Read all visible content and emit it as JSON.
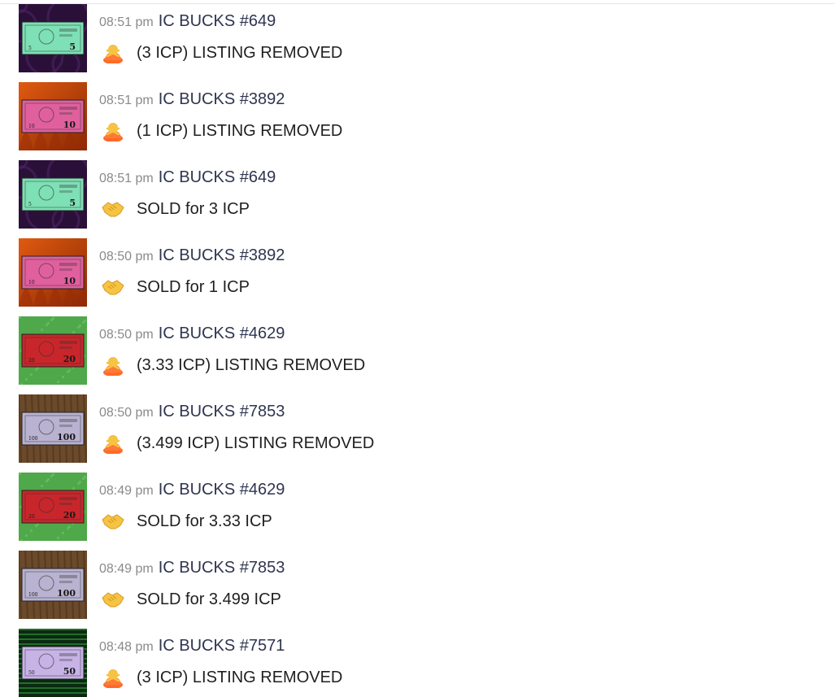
{
  "items": [
    {
      "time": "08:51 pm",
      "title": "IC BUCKS #649",
      "action": "(3 ICP) LISTING REMOVED",
      "action_icon": "person-gesturing-no-icon",
      "bill_value": "5",
      "bg": "#2a1038",
      "bill_color": "#7ee0b5",
      "pattern": "purple-swirl"
    },
    {
      "time": "08:51 pm",
      "title": "IC BUCKS #3892",
      "action": "(1 ICP) LISTING REMOVED",
      "action_icon": "person-gesturing-no-icon",
      "bill_value": "10",
      "bg": "#c23d0a",
      "bill_color": "#e0609e",
      "pattern": "orange-flame"
    },
    {
      "time": "08:51 pm",
      "title": "IC BUCKS #649",
      "action": "SOLD for 3 ICP",
      "action_icon": "handshake-icon",
      "bill_value": "5",
      "bg": "#2a1038",
      "bill_color": "#7ee0b5",
      "pattern": "purple-swirl"
    },
    {
      "time": "08:50 pm",
      "title": "IC BUCKS #3892",
      "action": "SOLD for 1 ICP",
      "action_icon": "handshake-icon",
      "bill_value": "10",
      "bg": "#c23d0a",
      "bill_color": "#e0609e",
      "pattern": "orange-flame"
    },
    {
      "time": "08:50 pm",
      "title": "IC BUCKS #4629",
      "action": "(3.33 ICP) LISTING REMOVED",
      "action_icon": "person-gesturing-no-icon",
      "bill_value": "20",
      "bg": "#4fa84a",
      "bill_color": "#c9262b",
      "pattern": "green-grass"
    },
    {
      "time": "08:50 pm",
      "title": "IC BUCKS #7853",
      "action": "(3.499 ICP) LISTING REMOVED",
      "action_icon": "person-gesturing-no-icon",
      "bill_value": "100",
      "bg": "#6b4a2c",
      "bill_color": "#b9b2d0",
      "pattern": "wood"
    },
    {
      "time": "08:49 pm",
      "title": "IC BUCKS #4629",
      "action": "SOLD for 3.33 ICP",
      "action_icon": "handshake-icon",
      "bill_value": "20",
      "bg": "#4fa84a",
      "bill_color": "#c9262b",
      "pattern": "green-grass"
    },
    {
      "time": "08:49 pm",
      "title": "IC BUCKS #7853",
      "action": "SOLD for 3.499 ICP",
      "action_icon": "handshake-icon",
      "bill_value": "100",
      "bg": "#6b4a2c",
      "bill_color": "#b9b2d0",
      "pattern": "wood"
    },
    {
      "time": "08:48 pm",
      "title": "IC BUCKS #7571",
      "action": "(3 ICP) LISTING REMOVED",
      "action_icon": "person-gesturing-no-icon",
      "bill_value": "50",
      "bg": "#0a2a10",
      "bill_color": "#c7b3e6",
      "pattern": "green-stripes"
    }
  ]
}
